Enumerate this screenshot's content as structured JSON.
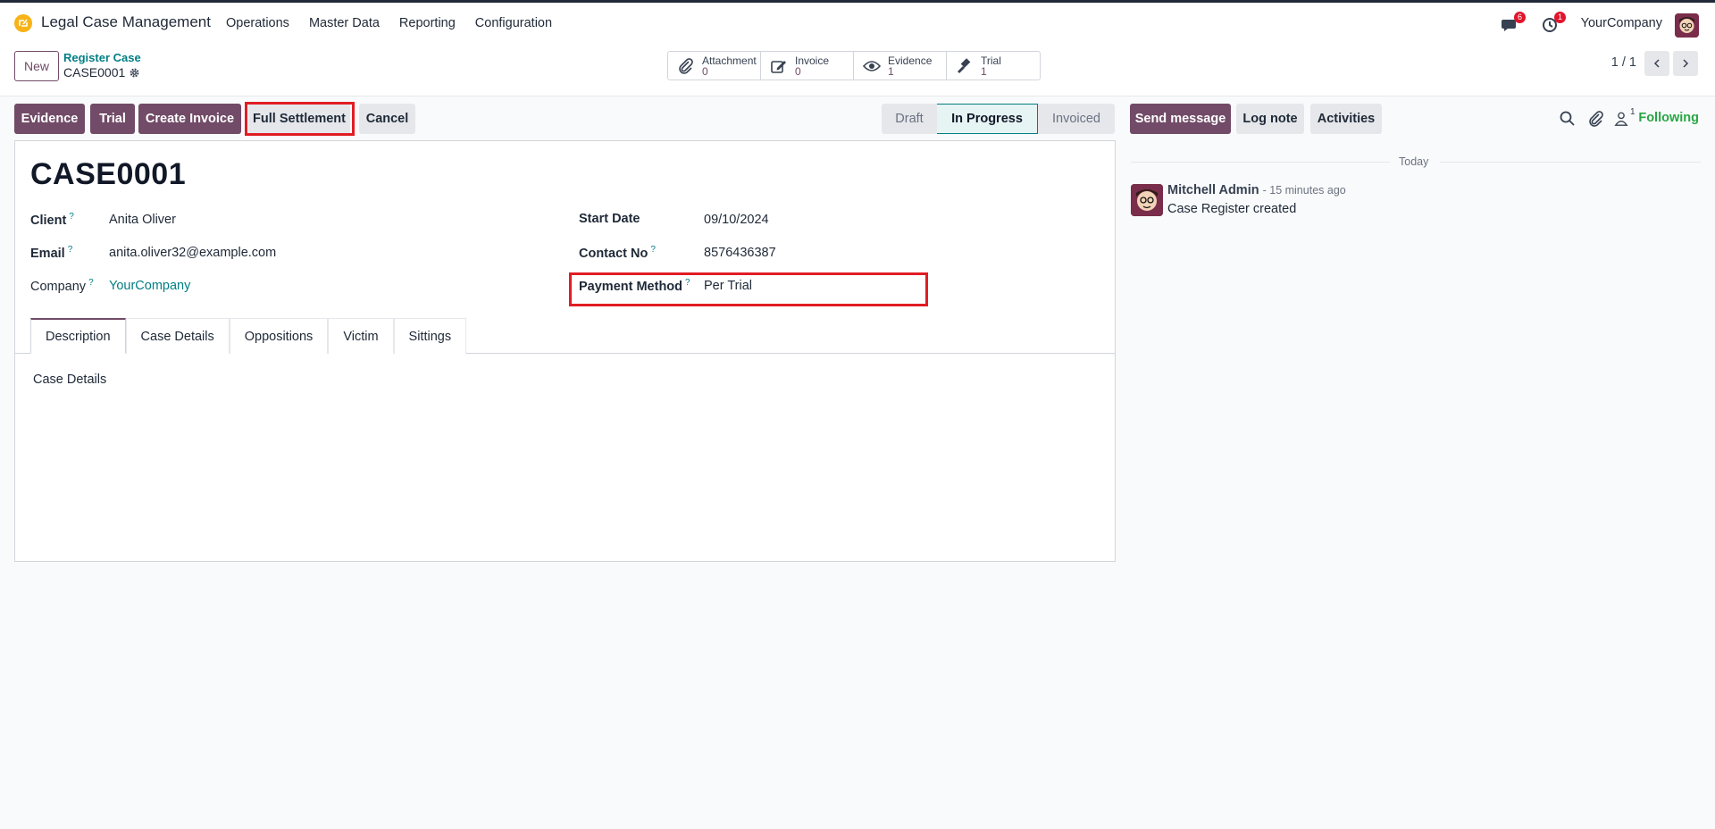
{
  "navbar": {
    "app_name": "Legal Case Management",
    "menu": [
      "Operations",
      "Master Data",
      "Reporting",
      "Configuration"
    ],
    "messages_badge": "6",
    "activities_badge": "1",
    "company": "YourCompany"
  },
  "control": {
    "new_label": "New",
    "breadcrumb_parent": "Register Case",
    "breadcrumb_current": "CASE0001",
    "smart_buttons": [
      {
        "label": "Attachment",
        "value": "0",
        "icon": "paperclip-icon"
      },
      {
        "label": "Invoice",
        "value": "0",
        "icon": "edit-icon"
      },
      {
        "label": "Evidence",
        "value": "1",
        "icon": "eye-icon"
      },
      {
        "label": "Trial",
        "value": "1",
        "icon": "gavel-icon"
      }
    ],
    "pager": "1 / 1"
  },
  "actions": {
    "evidence": "Evidence",
    "trial": "Trial",
    "create_invoice": "Create Invoice",
    "full_settlement": "Full Settlement",
    "cancel": "Cancel"
  },
  "status": {
    "stages": [
      "Draft",
      "In Progress",
      "Invoiced"
    ],
    "current": "In Progress"
  },
  "chatter": {
    "send_message": "Send message",
    "log_note": "Log note",
    "activities": "Activities",
    "followers_count": "1",
    "following": "Following",
    "date_divider": "Today",
    "message": {
      "author": "Mitchell Admin",
      "time": "- 15 minutes ago",
      "body": "Case Register created"
    }
  },
  "form": {
    "title": "CASE0001",
    "client_label": "Client",
    "client_value": "Anita Oliver",
    "email_label": "Email",
    "email_value": "anita.oliver32@example.com",
    "company_label": "Company",
    "company_value": "YourCompany",
    "start_date_label": "Start Date",
    "start_date_value": "09/10/2024",
    "contact_label": "Contact No",
    "contact_value": "8576436387",
    "payment_label": "Payment Method",
    "payment_value": "Per Trial",
    "help_mark": "?",
    "tabs": [
      "Description",
      "Case Details",
      "Oppositions",
      "Victim",
      "Sittings"
    ],
    "tab_content": "Case Details"
  },
  "colors": {
    "primary": "#714b67",
    "link": "#017e84",
    "highlight": "#e11d24",
    "following": "#28a745"
  }
}
